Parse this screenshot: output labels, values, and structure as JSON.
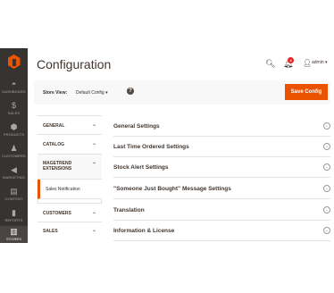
{
  "nav": {
    "items": [
      {
        "label": "DASHBOARD",
        "icon": "speedometer-icon",
        "glyph": "◓"
      },
      {
        "label": "SALES",
        "icon": "dollar-icon",
        "glyph": "$"
      },
      {
        "label": "PRODUCTS",
        "icon": "cube-icon",
        "glyph": "⬢"
      },
      {
        "label": "CUSTOMERS",
        "icon": "person-icon",
        "glyph": "♟"
      },
      {
        "label": "MARKETING",
        "icon": "megaphone-icon",
        "glyph": "◀"
      },
      {
        "label": "CONTENT",
        "icon": "layout-icon",
        "glyph": "▤"
      },
      {
        "label": "REPORTS",
        "icon": "bar-chart-icon",
        "glyph": "▮"
      },
      {
        "label": "STORES",
        "icon": "store-icon",
        "glyph": "▥",
        "active": true
      }
    ]
  },
  "header": {
    "title": "Configuration",
    "notification_count": "4",
    "user": "admin ▾"
  },
  "toolbar": {
    "store_view_label": "Store View:",
    "store_view_value": "Default Config ▾",
    "help": "?",
    "save_label": "Save Config"
  },
  "tabs": [
    {
      "label": "GENERAL",
      "chevron": "⌄"
    },
    {
      "label": "CATALOG",
      "chevron": "⌄"
    },
    {
      "label": "MAGETREND EXTENSIONS",
      "line1": "MAGETREND",
      "line2": "EXTENSIONS",
      "chevron": "⌃"
    },
    {
      "label": "Sales Notification"
    },
    {
      "label": "CUSTOMERS",
      "chevron": "⌄"
    },
    {
      "label": "SALES",
      "chevron": "⌄"
    }
  ],
  "sections": [
    {
      "label": "General Settings"
    },
    {
      "label": "Last Time Ordered Settings"
    },
    {
      "label": "Stock Alert Settings"
    },
    {
      "label": "\"Someone Just Bought\" Message Settings"
    },
    {
      "label": "Translation"
    },
    {
      "label": "Information & License"
    }
  ],
  "colors": {
    "accent": "#eb5202",
    "nav_bg": "#373330",
    "badge": "#e22626"
  }
}
